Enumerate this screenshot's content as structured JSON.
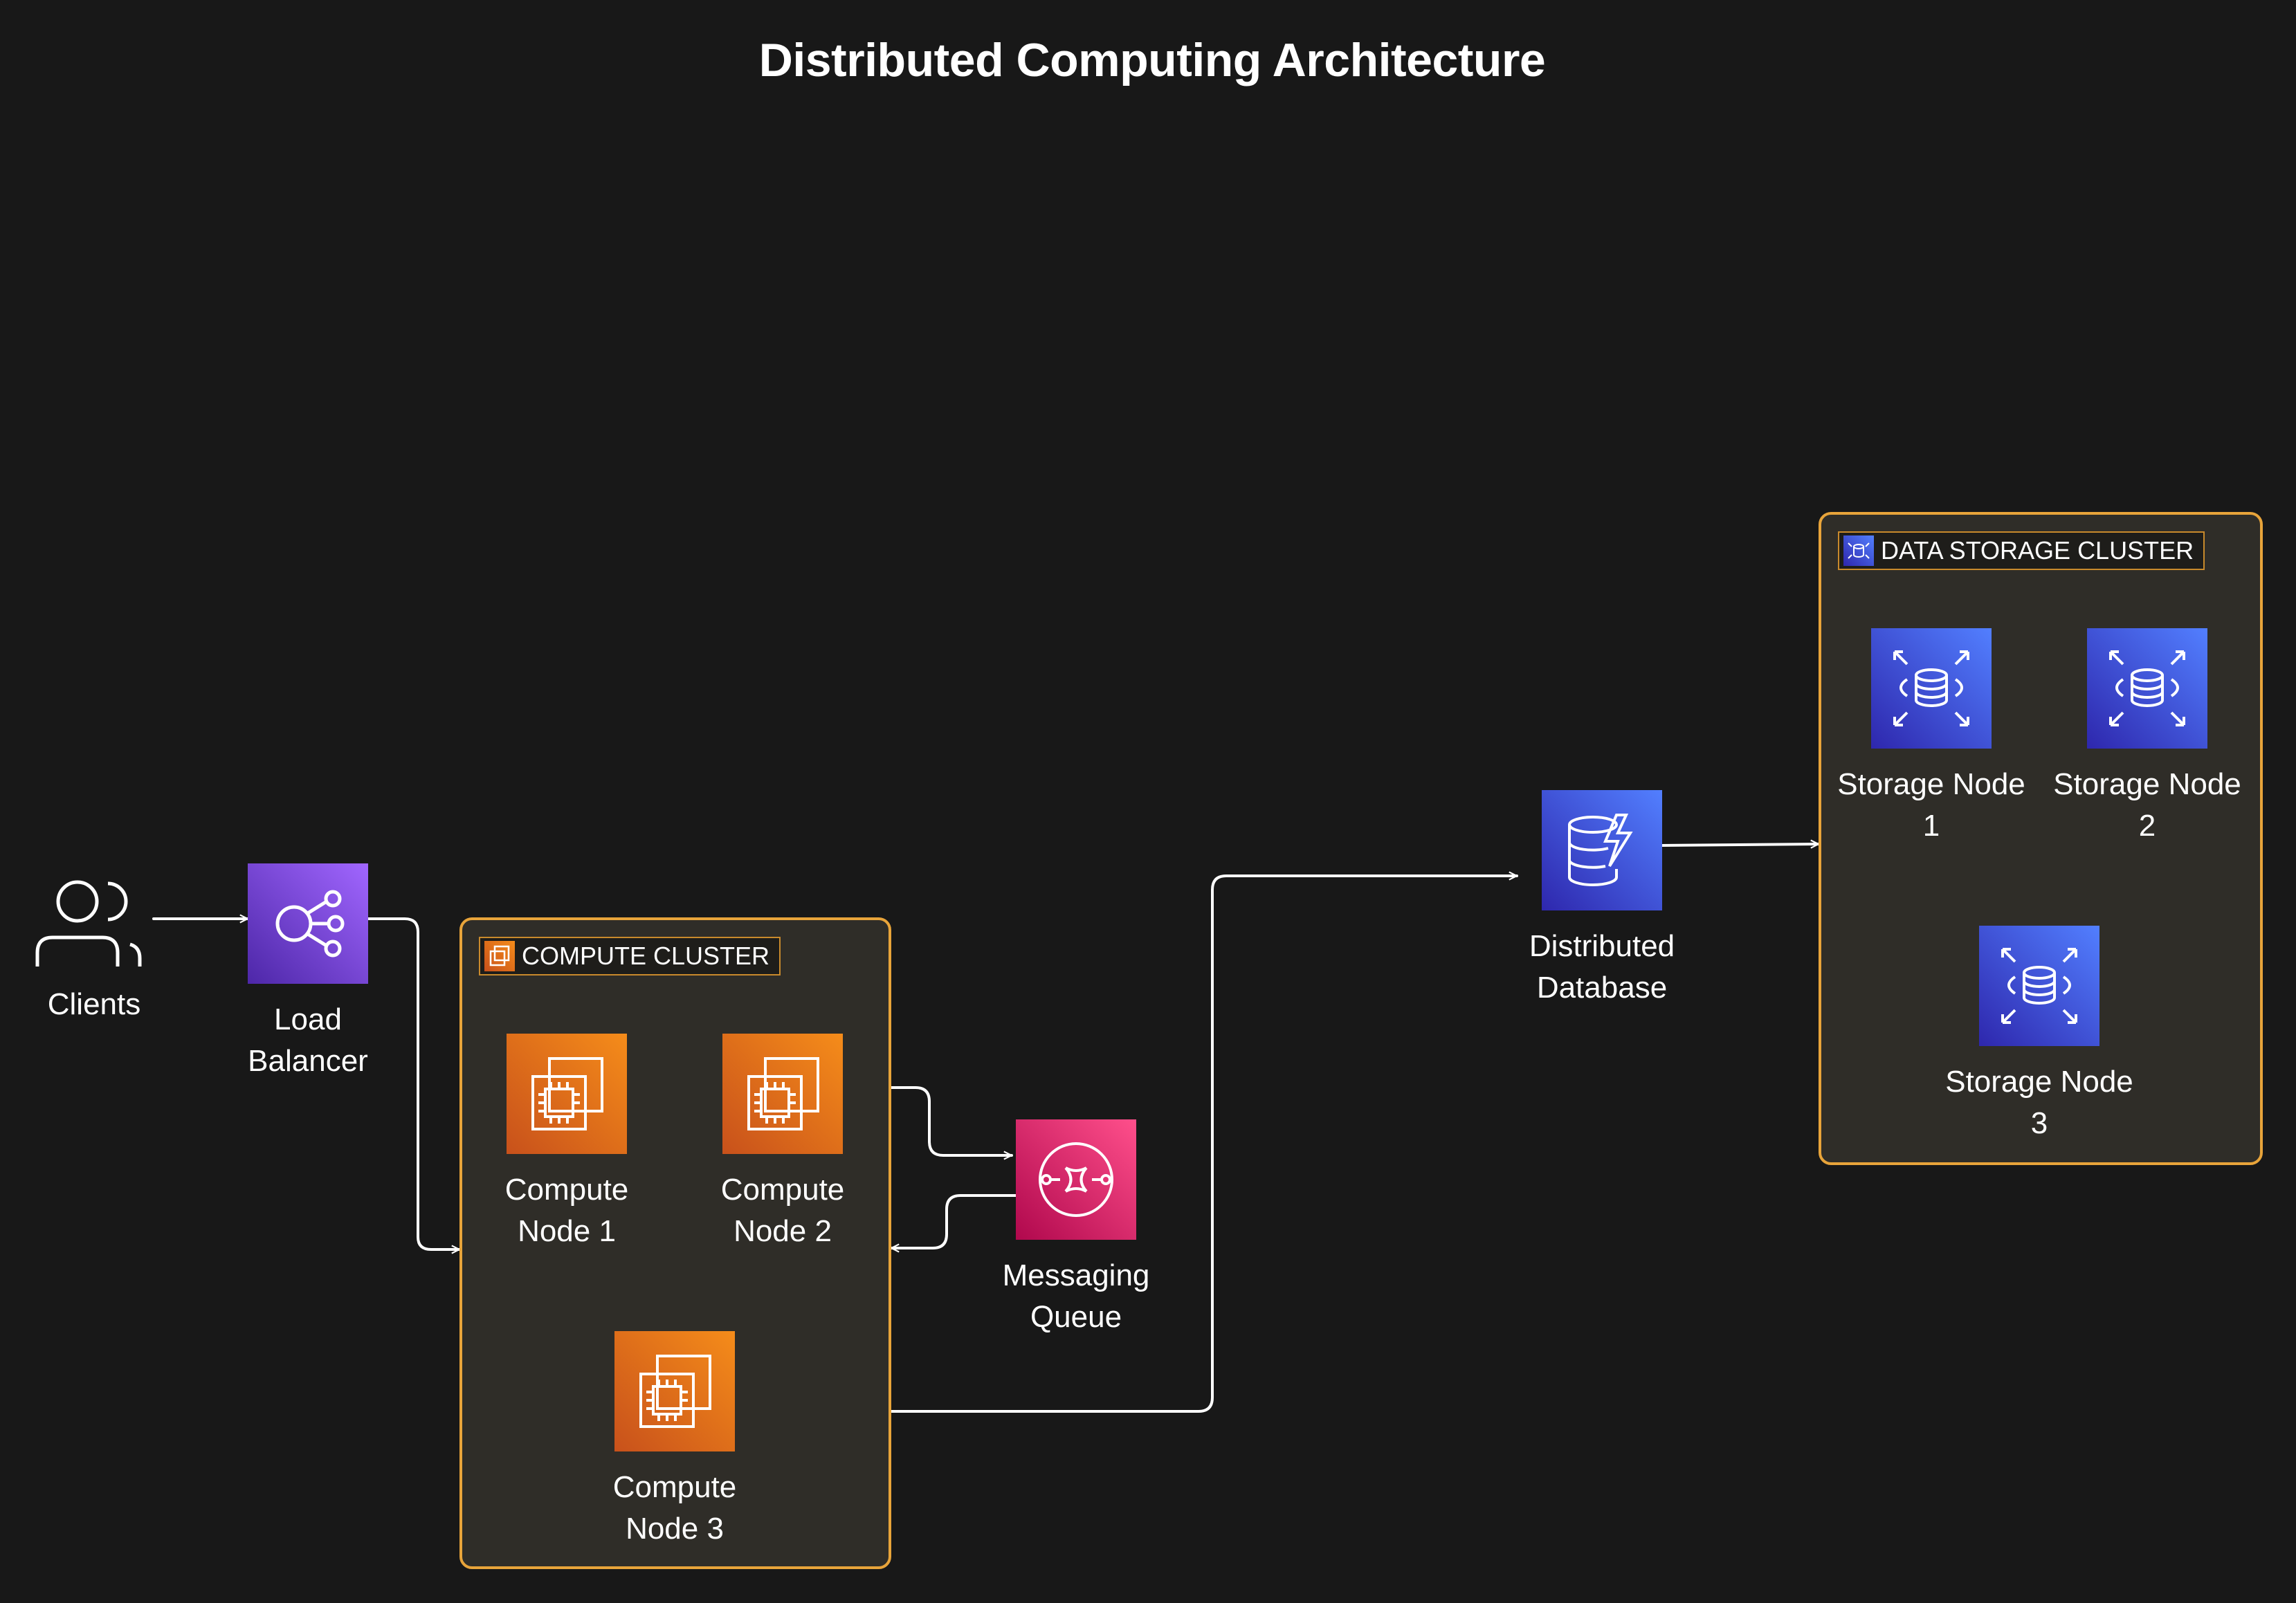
{
  "title": "Distributed Computing Architecture",
  "colors": {
    "background": "#181818",
    "group_border": "#e8a43a",
    "group_fill": "#2f2d28",
    "compute": "#f58c1a",
    "load_balancer": "#a166ff",
    "messaging": "#ff4f8b",
    "database": "#527fff",
    "edge": "#ffffff"
  },
  "groups": [
    {
      "id": "compute-cluster",
      "label": "COMPUTE CLUSTER",
      "icon": "ec2-group-icon"
    },
    {
      "id": "data-storage-cluster",
      "label": "DATA STORAGE CLUSTER",
      "icon": "database-group-icon"
    }
  ],
  "nodes": {
    "clients": {
      "label": "Clients",
      "icon": "users-icon"
    },
    "load_balancer": {
      "label": "Load\nBalancer",
      "icon": "load-balancer-icon"
    },
    "compute1": {
      "label": "Compute\nNode 1",
      "icon": "ec2-instance-icon"
    },
    "compute2": {
      "label": "Compute\nNode 2",
      "icon": "ec2-instance-icon"
    },
    "compute3": {
      "label": "Compute\nNode 3",
      "icon": "ec2-instance-icon"
    },
    "queue": {
      "label": "Messaging\nQueue",
      "icon": "sqs-queue-icon"
    },
    "database": {
      "label": "Distributed\nDatabase",
      "icon": "dynamodb-icon"
    },
    "storage1": {
      "label": "Storage Node\n1",
      "icon": "rds-icon"
    },
    "storage2": {
      "label": "Storage Node\n2",
      "icon": "rds-icon"
    },
    "storage3": {
      "label": "Storage Node\n3",
      "icon": "rds-icon"
    }
  },
  "edges": [
    {
      "from": "clients",
      "to": "load_balancer"
    },
    {
      "from": "load_balancer",
      "to": "compute-cluster"
    },
    {
      "from": "compute-cluster",
      "to": "queue"
    },
    {
      "from": "queue",
      "to": "compute-cluster"
    },
    {
      "from": "compute-cluster",
      "to": "database"
    },
    {
      "from": "database",
      "to": "data-storage-cluster"
    }
  ]
}
